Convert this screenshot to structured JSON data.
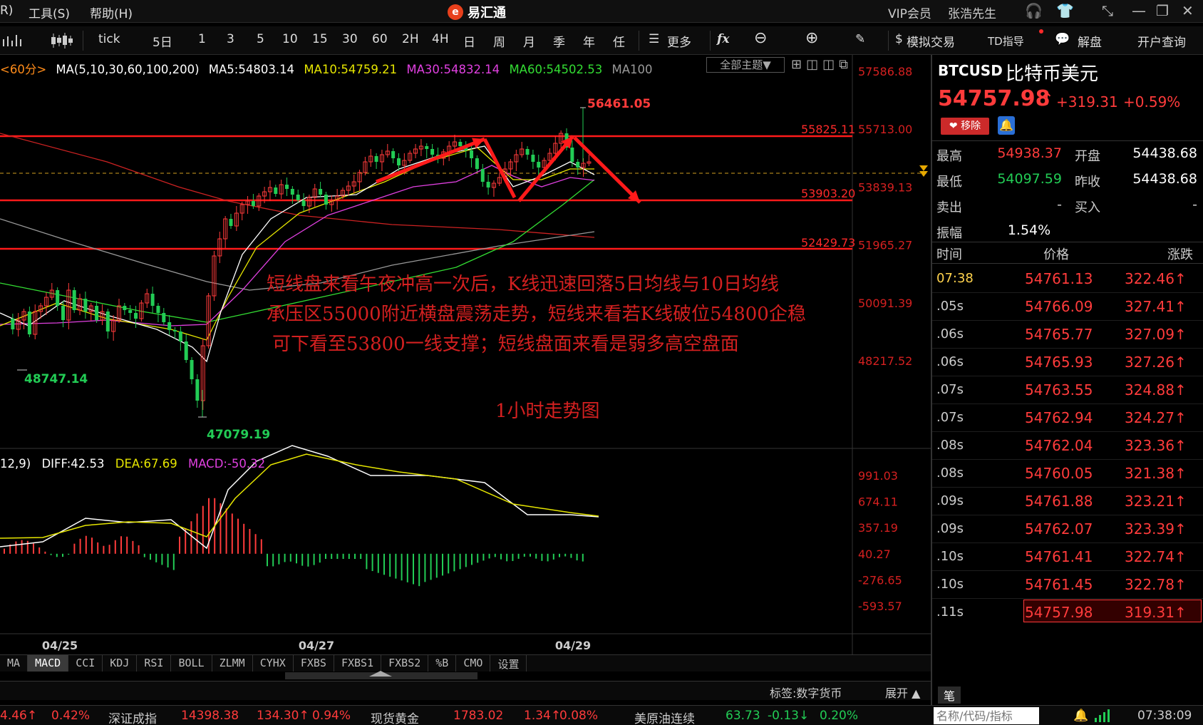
{
  "menu": {
    "left_partial": "R)",
    "tools": "工具(S)",
    "help": "帮助(H)"
  },
  "brand": {
    "logo": "e",
    "name": "易汇通"
  },
  "title_right": {
    "vip": "VIP会员",
    "user": "张浩先生"
  },
  "toolbar": {
    "periods": [
      "tick",
      "5日",
      "1",
      "3",
      "5",
      "10",
      "15",
      "30",
      "60",
      "2H",
      "4H",
      "日",
      "周",
      "月",
      "季",
      "年",
      "任"
    ],
    "more": "更多",
    "fx": "fx",
    "sim_trade": "模拟交易",
    "td_guide": "TD指导",
    "analysis": "解盘",
    "account_query": "开户查询"
  },
  "ma_legend": {
    "period": "<60分>",
    "name": "MA(5,10,30,60,100,200)",
    "ma5": "MA5:54803.14",
    "ma10": "MA10:54759.21",
    "ma30": "MA30:54832.14",
    "ma60": "MA60:54502.53",
    "ma100": "MA100"
  },
  "theme_button": "全部主题▼",
  "macd_legend": {
    "params": "12,9)",
    "diff": "DIFF:42.53",
    "dea": "DEA:67.69",
    "macd": "MACD:-50.32"
  },
  "price_axis": [
    "57586.88",
    "55713.00",
    "53839.13",
    "51965.27",
    "50091.39",
    "48217.52"
  ],
  "macd_axis": [
    "991.03",
    "674.11",
    "357.19",
    "40.27",
    "-276.65",
    "-593.57"
  ],
  "date_axis": [
    "04/25",
    "04/27",
    "04/29"
  ],
  "price_labels": {
    "high_peak": "56461.05",
    "res1": "55825.11",
    "sup1": "53903.20",
    "sup2": "52429.73",
    "low1": "48747.14",
    "low2": "47079.19"
  },
  "annotations": {
    "line1": "短线盘来看午夜冲高一次后，K线迅速回落5日均线与10日均线",
    "line2": "承压区55000附近横盘震荡走势，短线来看若K线破位54800企稳",
    "line3": "可下看至53800一线支撑；短线盘面来看是弱多高空盘面",
    "caption": "1小时走势图"
  },
  "indicator_tabs": [
    "MA",
    "MACD",
    "CCI",
    "KDJ",
    "RSI",
    "BOLL",
    "ZLMM",
    "CYHX",
    "FXBS",
    "FXBS1",
    "FXBS2",
    "%B",
    "CMO",
    "设置"
  ],
  "tag_bar": {
    "label": "标签:数字货币",
    "expand": "展开 ▲"
  },
  "quote": {
    "code": "BTCUSD",
    "name": "比特币美元",
    "price": "54757.98",
    "arrow": "↑",
    "change": "+319.31",
    "change_pct": "+0.59%",
    "remove": "移除",
    "stats": [
      {
        "label": "最高",
        "value": "54938.37",
        "label2": "开盘",
        "value2": "54438.68"
      },
      {
        "label": "最低",
        "value": "54097.59",
        "label2": "昨收",
        "value2": "54438.68"
      },
      {
        "label": "卖出",
        "value": "-",
        "label2": "买入",
        "value2": "-"
      },
      {
        "label": "振幅",
        "value": "1.54%"
      }
    ],
    "tick_headers": [
      "时间",
      "价格",
      "涨跌"
    ],
    "ticks": [
      {
        "time": "07:38",
        "price": "54761.13",
        "chg": "322.46↑"
      },
      {
        "time": ".05s",
        "price": "54766.09",
        "chg": "327.41↑"
      },
      {
        "time": ".06s",
        "price": "54765.77",
        "chg": "327.09↑"
      },
      {
        "time": ".06s",
        "price": "54765.93",
        "chg": "327.26↑"
      },
      {
        "time": ".07s",
        "price": "54763.55",
        "chg": "324.88↑"
      },
      {
        "time": ".07s",
        "price": "54762.94",
        "chg": "324.27↑"
      },
      {
        "time": ".08s",
        "price": "54762.04",
        "chg": "323.36↑"
      },
      {
        "time": ".08s",
        "price": "54760.05",
        "chg": "321.38↑"
      },
      {
        "time": ".09s",
        "price": "54761.88",
        "chg": "323.21↑"
      },
      {
        "time": ".09s",
        "price": "54762.07",
        "chg": "323.39↑"
      },
      {
        "time": ".10s",
        "price": "54761.41",
        "chg": "322.74↑"
      },
      {
        "time": ".10s",
        "price": "54761.45",
        "chg": "322.78↑"
      },
      {
        "time": ".11s",
        "price": "54757.98",
        "chg": "319.31↑"
      }
    ],
    "pen_tab": "笔"
  },
  "status": {
    "items": [
      {
        "text": "4.46↑",
        "color": "#ff3b3b"
      },
      {
        "text": "0.42%",
        "color": "#ff3b3b"
      },
      {
        "text": "深证成指",
        "color": "#cccccc"
      },
      {
        "text": "14398.38",
        "color": "#ff3b3b"
      },
      {
        "text": "134.30↑",
        "color": "#ff3b3b"
      },
      {
        "text": "0.94%",
        "color": "#ff3b3b"
      },
      {
        "text": "现货黄金",
        "color": "#cccccc"
      },
      {
        "text": "1783.02",
        "color": "#ff3b3b"
      },
      {
        "text": "1.34↑",
        "color": "#ff3b3b"
      },
      {
        "text": "0.08%",
        "color": "#ff3b3b"
      },
      {
        "text": "美原油连续",
        "color": "#cccccc"
      },
      {
        "text": "63.73",
        "color": "#22cc55"
      },
      {
        "text": "-0.13↓",
        "color": "#22cc55"
      },
      {
        "text": "0.20%",
        "color": "#22cc55"
      }
    ],
    "search_placeholder": "名称/代码/指标",
    "time": "07:38:09"
  },
  "colors": {
    "up": "#ff3b3b",
    "down": "#22cc55",
    "ma5": "#ffffff",
    "ma10": "#e6e600",
    "ma30": "#e040e0",
    "ma60": "#33dd33",
    "ma100": "#999999",
    "ma200": "#cc2222"
  }
}
